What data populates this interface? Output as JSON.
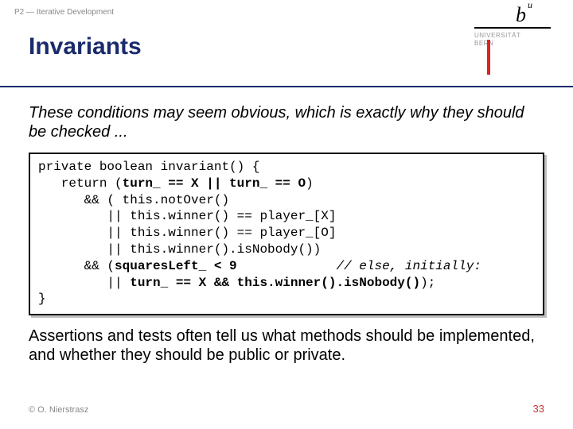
{
  "breadcrumb": "P2 — Iterative Development",
  "logo": {
    "letter": "b",
    "sup": "u",
    "uni": "UNIVERSITÄT",
    "bern": "BERN"
  },
  "title": "Invariants",
  "intro": "These conditions may seem obvious, which is exactly why they should be checked ...",
  "code": {
    "l1a": "private boolean invariant() {",
    "l2a": "   return (",
    "l2b": "turn_ == X || turn_ == O",
    "l2c": ")",
    "l3a": "      && ( this.notOver()",
    "l4a": "         || this.winner() == player_[X]",
    "l5a": "         || this.winner() == player_[O]",
    "l6a": "         || this.winner().isNobody())",
    "l7a": "      && (",
    "l7b": "squaresLeft_ < 9",
    "l7c": "             ",
    "l7d": "// else, initially:",
    "l8a": "         || ",
    "l8b": "turn_ == X && this.winner().isNobody()",
    "l8c": ");",
    "l9a": "}"
  },
  "outro": "Assertions and tests often tell us what methods should be implemented, and whether they should be public or private.",
  "footer": {
    "copyright": "© O. Nierstrasz",
    "page": "33"
  }
}
